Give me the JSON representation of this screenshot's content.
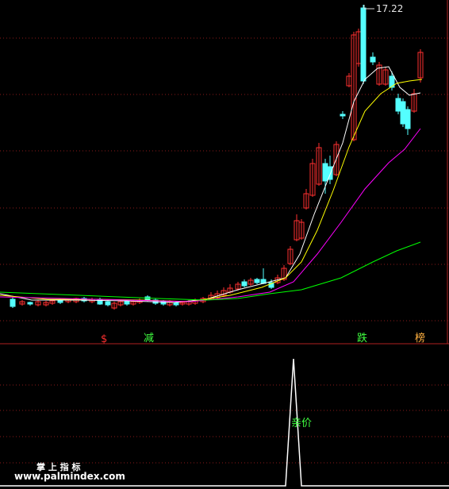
{
  "chart_data": [
    {
      "type": "candlestick",
      "title": "",
      "price_high_label": "17.22",
      "moving_averages": [
        {
          "color": "#ffffff"
        },
        {
          "color": "#ffff00"
        },
        {
          "color": "#ff00ff"
        },
        {
          "color": "#00ff00"
        }
      ],
      "signals": [
        {
          "text": "$",
          "color": "#ff3030"
        },
        {
          "text": "减",
          "color": "#40ff40"
        },
        {
          "text": "跌",
          "color": "#40ff40"
        },
        {
          "text": "榜",
          "color": "#ffb040"
        }
      ],
      "up_color": "#ff3030",
      "down_color": "#54ffff"
    },
    {
      "type": "line",
      "annotation": "亲价",
      "annotation_color": "#40ff40",
      "line_color": "#ffffff"
    }
  ],
  "watermark": {
    "title": "掌 上 指 标",
    "url": "www.palmindex.com"
  }
}
